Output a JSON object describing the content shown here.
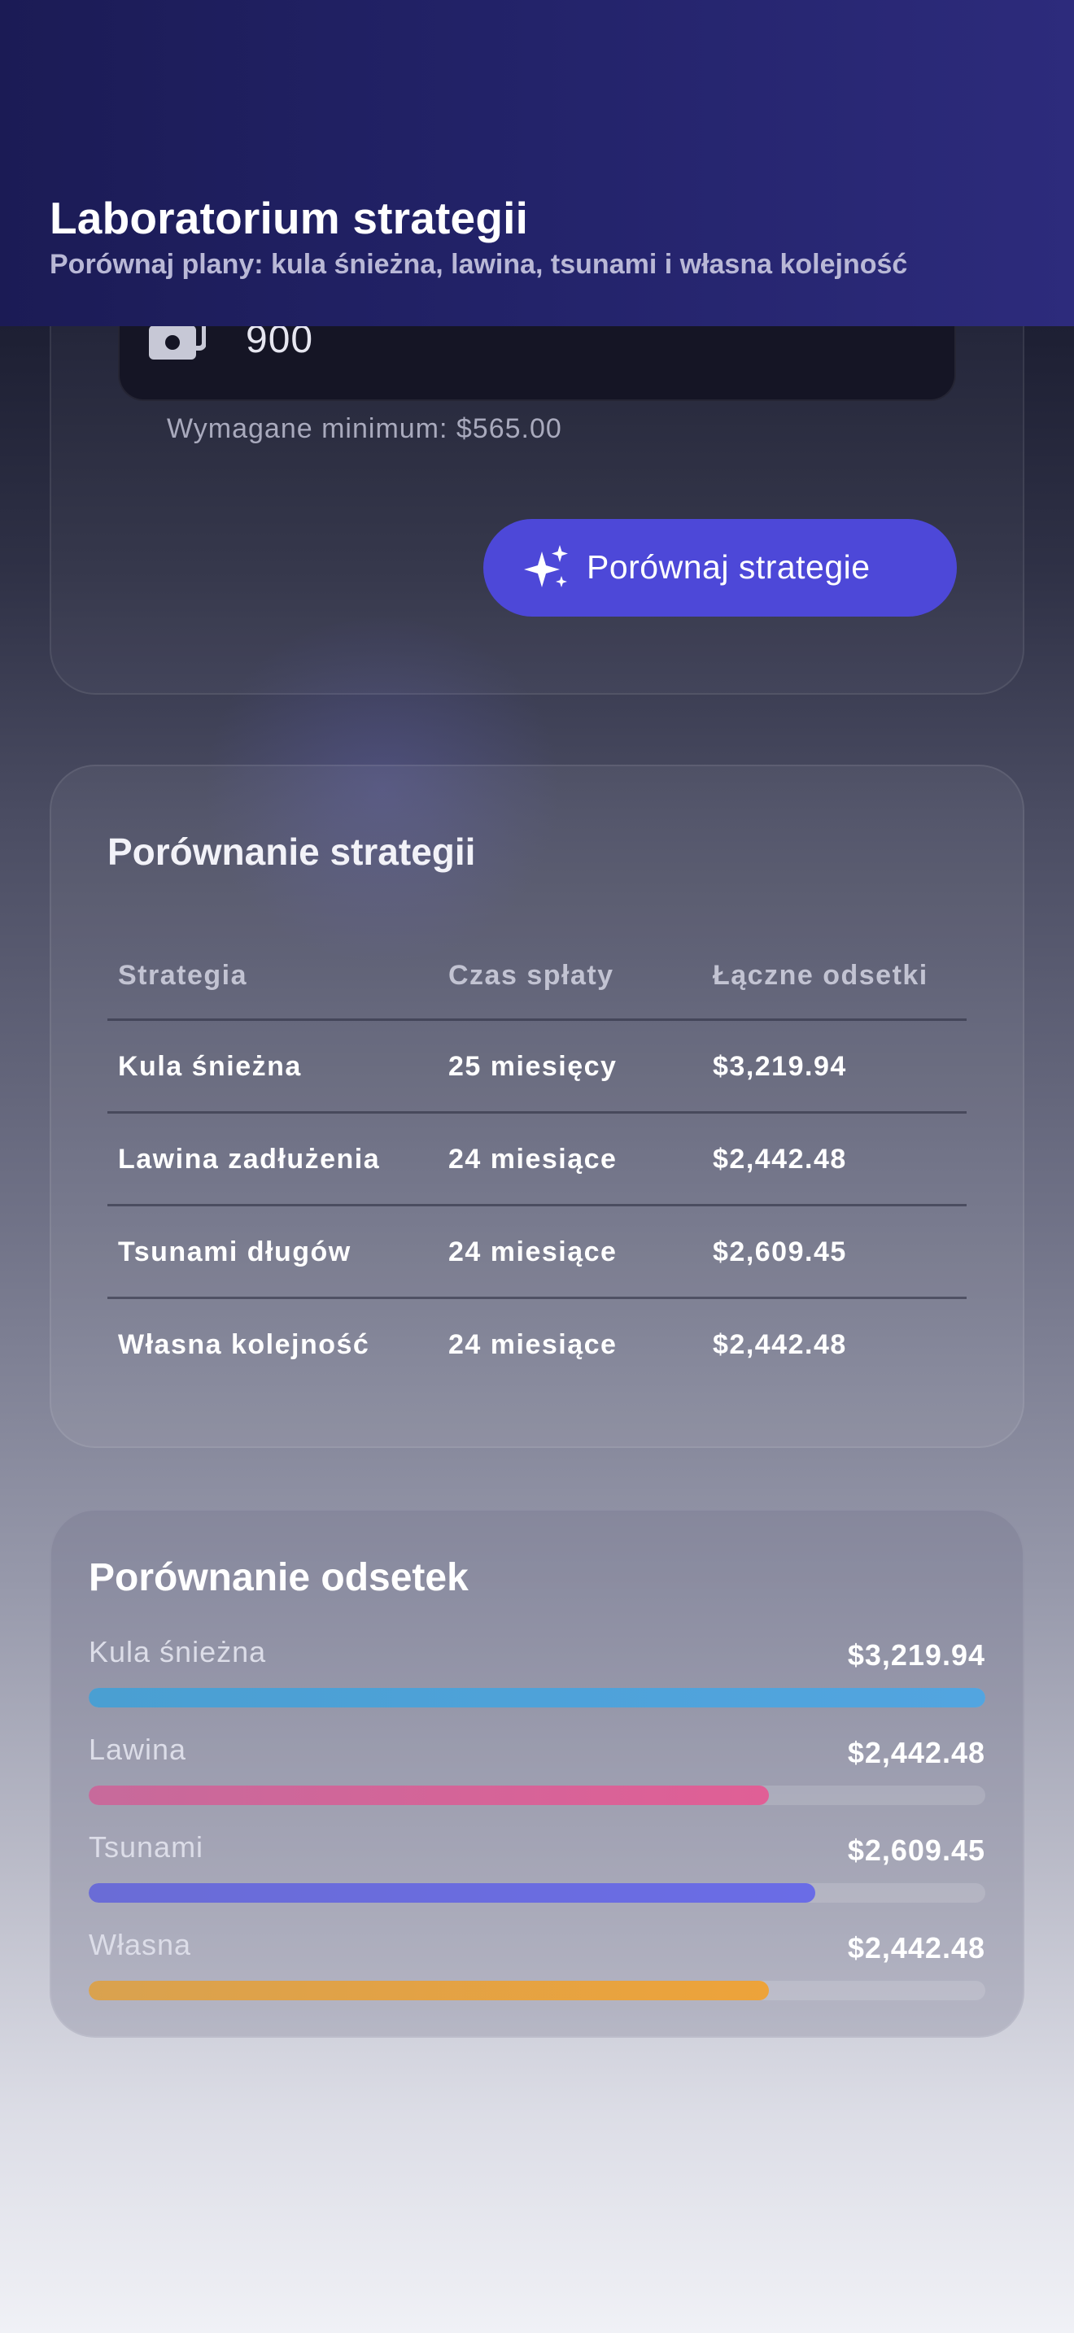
{
  "header": {
    "title": "Laboratorium strategii",
    "subtitle": "Porównaj plany: kula śnieżna, lawina, tsunami i własna kolejność"
  },
  "payment": {
    "amount": "900",
    "icon": "money-icon",
    "minimum_note": "Wymagane minimum: $565.00"
  },
  "compare_button": {
    "label": "Porównaj strategie",
    "icon": "sparkles-icon"
  },
  "comparison": {
    "title": "Porównanie strategii",
    "columns": [
      "Strategia",
      "Czas spłaty",
      "Łączne odsetki"
    ],
    "rows": [
      {
        "strategy": "Kula śnieżna",
        "time": "25 miesięcy",
        "interest": "$3,219.94"
      },
      {
        "strategy": "Lawina zadłużenia",
        "time": "24 miesiące",
        "interest": "$2,442.48"
      },
      {
        "strategy": "Tsunami długów",
        "time": "24 miesiące",
        "interest": "$2,609.45"
      },
      {
        "strategy": "Własna kolejność",
        "time": "24 miesiące",
        "interest": "$2,442.48"
      }
    ]
  },
  "interest_chart": {
    "title": "Porównanie odsetek",
    "bars": [
      {
        "label": "Kula śnieżna",
        "value_text": "$3,219.94",
        "value": 3219.94,
        "color_start": "#4a9fd2",
        "color_end": "#52a5e0"
      },
      {
        "label": "Lawina",
        "value_text": "$2,442.48",
        "value": 2442.48,
        "color_start": "#c76a9b",
        "color_end": "#e05f96"
      },
      {
        "label": "Tsunami",
        "value_text": "$2,609.45",
        "value": 2609.45,
        "color_start": "#6a6cd6",
        "color_end": "#6a6ce6"
      },
      {
        "label": "Własna",
        "value_text": "$2,442.48",
        "value": 2442.48,
        "color_start": "#d9a24f",
        "color_end": "#eda33a"
      }
    ],
    "max_value": 3219.94
  }
}
